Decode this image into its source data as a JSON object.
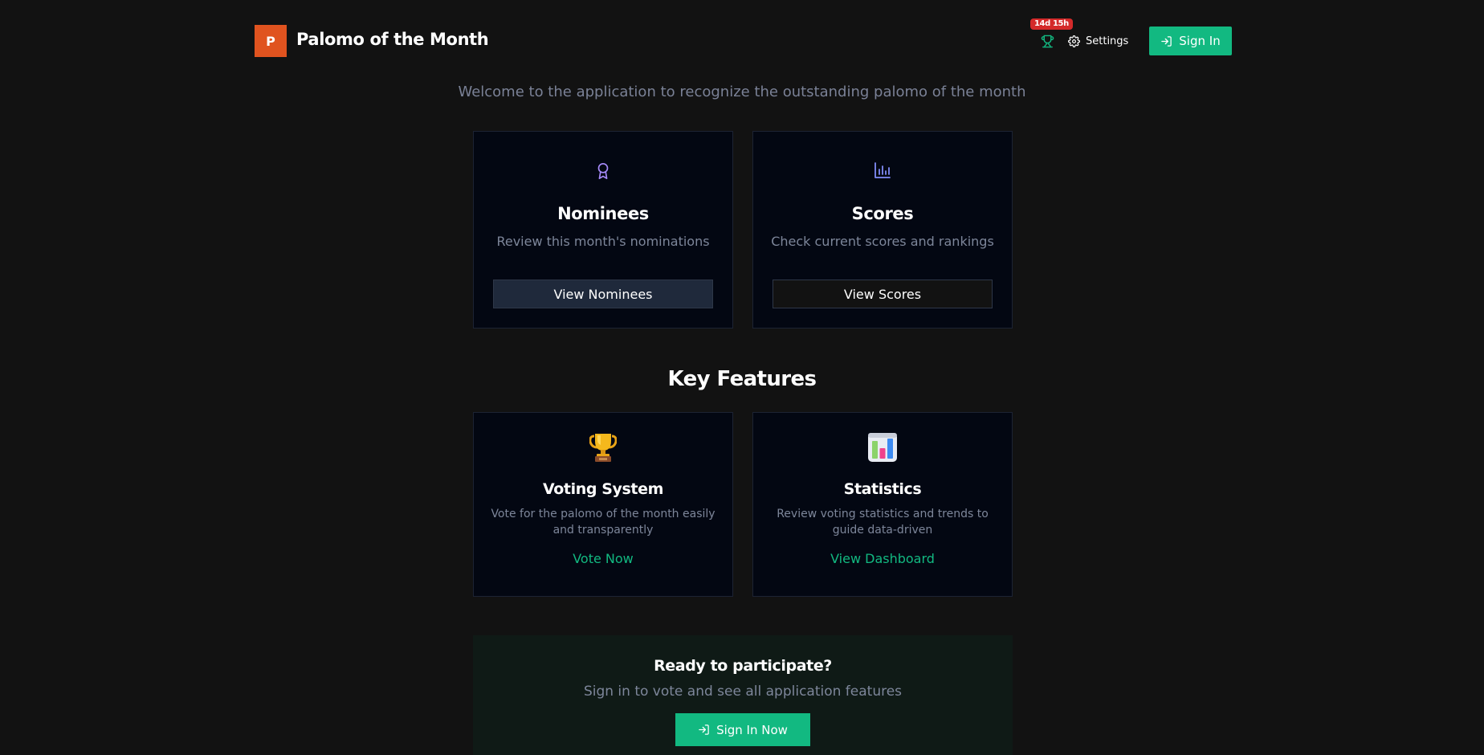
{
  "header": {
    "logo_letter": "P",
    "title": "Palomo of the Month",
    "countdown": "14d 15h",
    "settings_label": "Settings",
    "sign_in_label": "Sign In"
  },
  "welcome": "Welcome to the application to recognize the outstanding palomo of the month",
  "cards": [
    {
      "icon": "award-icon",
      "title": "Nominees",
      "description": "Review this month's nominations",
      "button": "View Nominees"
    },
    {
      "icon": "bar-chart-icon",
      "title": "Scores",
      "description": "Check current scores and rankings",
      "button": "View Scores"
    }
  ],
  "features": {
    "title": "Key Features",
    "items": [
      {
        "icon": "trophy-emoji-icon",
        "title": "Voting System",
        "description": "Vote for the palomo of the month easily and transparently",
        "link": "Vote Now"
      },
      {
        "icon": "bar-chart-emoji-icon",
        "title": "Statistics",
        "description": "Review voting statistics and trends to guide data-driven",
        "link": "View Dashboard"
      }
    ]
  },
  "cta": {
    "title": "Ready to participate?",
    "subtitle": "Sign in to vote and see all application features",
    "button": "Sign In Now"
  },
  "colors": {
    "background": "#121212",
    "card_background": "#030712",
    "accent_green": "#12b981",
    "logo_orange": "#e0531f",
    "badge_red": "#d42a2a",
    "icon_purple": "#a78bfa",
    "icon_indigo": "#818cf8"
  }
}
